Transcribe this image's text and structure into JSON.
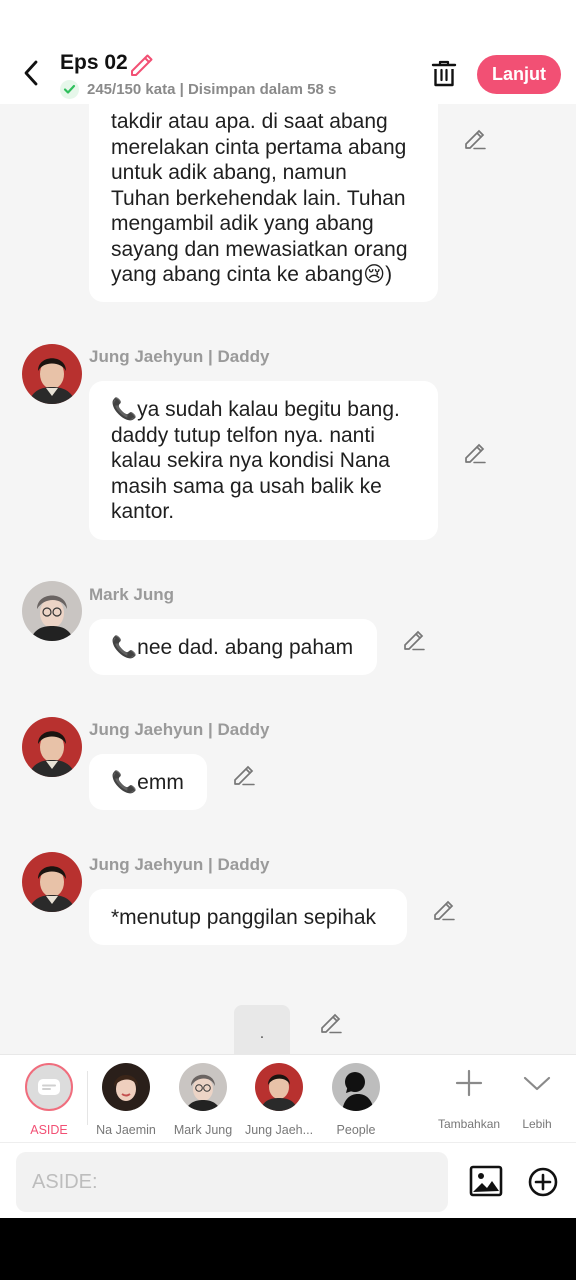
{
  "header": {
    "title": "Eps 02",
    "status": "245/150 kata | Disimpan dalam 58 s",
    "next_label": "Lanjut"
  },
  "messages": [
    {
      "sender": "",
      "lines": [
        "takdir atau apa. di saat abang",
        "merelakan cinta pertama abang",
        "untuk adik abang, namun",
        "Tuhan berkehendak lain. Tuhan",
        "mengambil adik yang abang",
        "sayang dan mewasiatkan orang",
        "yang abang cinta ke abang😢)"
      ]
    },
    {
      "sender": "Jung Jaehyun | Daddy",
      "lines": [
        "📞ya sudah kalau begitu bang.",
        "daddy tutup telfon nya. nanti",
        "kalau sekira nya kondisi Nana",
        "masih sama ga usah balik ke",
        "kantor."
      ]
    },
    {
      "sender": "Mark Jung",
      "lines": [
        "📞nee dad. abang paham"
      ]
    },
    {
      "sender": "Jung Jaehyun | Daddy",
      "lines": [
        "📞emm"
      ]
    },
    {
      "sender": "Jung Jaehyun | Daddy",
      "lines": [
        "*menutup panggilan sepihak"
      ]
    },
    {
      "sender": "",
      "lines": [
        "."
      ]
    }
  ],
  "characters": [
    {
      "label": "ASIDE"
    },
    {
      "label": "Na Jaemin"
    },
    {
      "label": "Mark Jung"
    },
    {
      "label": "Jung Jaeh..."
    },
    {
      "label": "People"
    }
  ],
  "tools": {
    "add_label": "Tambahkan",
    "more_label": "Lebih"
  },
  "input": {
    "placeholder": "ASIDE:"
  },
  "colors": {
    "accent": "#f25074",
    "bubble": "#ffffff",
    "background": "#f5f5f5"
  }
}
